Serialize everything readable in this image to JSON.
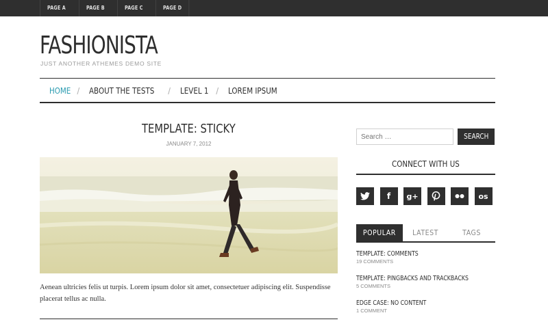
{
  "topbar": {
    "items": [
      "PAGE A",
      "PAGE B",
      "PAGE C",
      "PAGE D"
    ]
  },
  "site": {
    "title": "FASHIONISTA",
    "description": "JUST ANOTHER ATHEMES DEMO SITE"
  },
  "nav": {
    "items": [
      "HOME",
      "ABOUT THE TESTS",
      "LEVEL 1",
      "LOREM IPSUM"
    ],
    "active": "HOME",
    "separator": "/"
  },
  "post": {
    "title": "TEMPLATE: STICKY",
    "date": "JANUARY 7, 2012",
    "excerpt": "Aenean ultricies felis ut turpis. Lorem ipsum dolor sit amet, consectetuer adipiscing elit. Suspendisse placerat tellus ac nulla."
  },
  "sidebar": {
    "search": {
      "placeholder": "Search …",
      "button": "SEARCH"
    },
    "connect": {
      "title": "CONNECT WITH US",
      "icons": [
        {
          "name": "twitter-icon",
          "glyph": "🐦"
        },
        {
          "name": "facebook-icon",
          "glyph": "f"
        },
        {
          "name": "google-plus-icon",
          "glyph": "g+"
        },
        {
          "name": "pinterest-icon",
          "glyph": "P"
        },
        {
          "name": "flickr-icon",
          "glyph": "●●"
        },
        {
          "name": "lastfm-icon",
          "glyph": "os"
        }
      ]
    },
    "tabs": [
      "POPULAR",
      "LATEST",
      "TAGS"
    ],
    "popular": [
      {
        "title": "TEMPLATE: COMMENTS",
        "count": "19 COMMENTS"
      },
      {
        "title": "TEMPLATE: PINGBACKS AND TRACKBACKS",
        "count": "5 COMMENTS"
      },
      {
        "title": "EDGE CASE: NO CONTENT",
        "count": "1 COMMENT"
      }
    ]
  },
  "colors": {
    "accent": "#2a9bb0",
    "dark": "#2f2f2f"
  }
}
